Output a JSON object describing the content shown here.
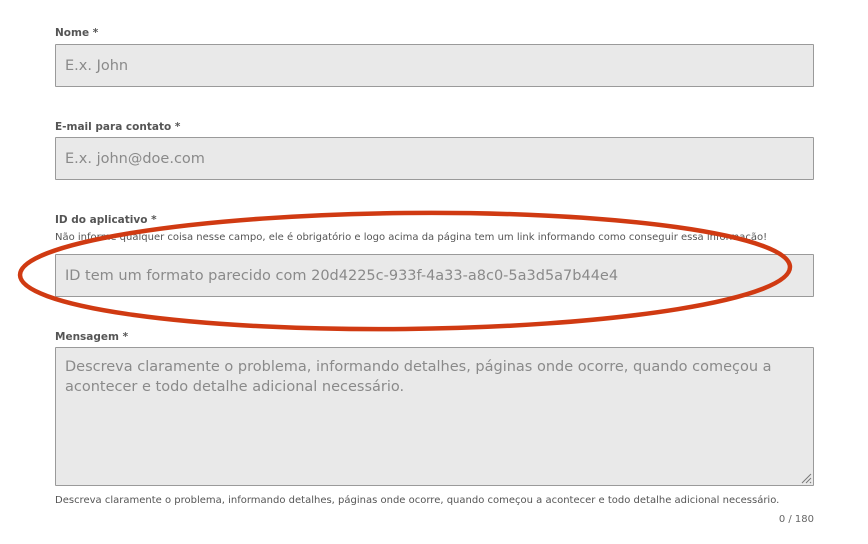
{
  "form": {
    "name_field": {
      "label": "Nome *",
      "placeholder": "E.x. John",
      "value": ""
    },
    "email_field": {
      "label": "E-mail para contato *",
      "placeholder": "E.x. john@doe.com",
      "value": ""
    },
    "app_id_field": {
      "label": "ID do aplicativo *",
      "hint": "Não informe qualquer coisa nesse campo, ele é obrigatório e logo acima da página tem um link informando como conseguir essa informação!",
      "placeholder": "ID tem um formato parecido com 20d4225c-933f-4a33-a8c0-5a3d5a7b44e4",
      "value": ""
    },
    "message_field": {
      "label": "Mensagem *",
      "placeholder": "Descreva claramente o problema, informando detalhes, páginas onde ocorre, quando começou a acontecer e todo detalhe adicional necessário.",
      "helper": "Descreva claramente o problema, informando detalhes, páginas onde ocorre, quando começou a acontecer e todo detalhe adicional necessário.",
      "counter": "0 / 180",
      "value": ""
    }
  },
  "colors": {
    "field_background": "#e9e9e9",
    "field_border": "#9a9a9a",
    "annotation": "#d03a12"
  }
}
